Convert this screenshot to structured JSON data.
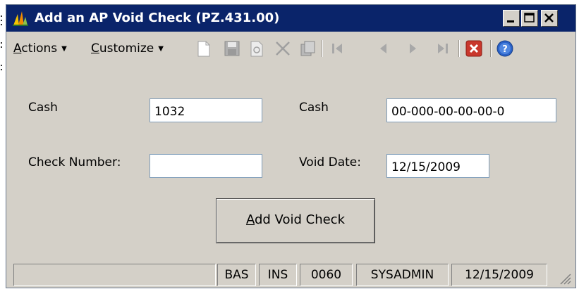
{
  "window": {
    "title": "Add an AP Void Check (PZ.431.00)"
  },
  "menu": {
    "actions_prefix": "A",
    "actions_rest": "ctions",
    "customize_prefix": "C",
    "customize_rest": "ustomize"
  },
  "form": {
    "cash_label_left": "Cash",
    "cash_value_left": "1032",
    "cash_label_right": "Cash",
    "cash_value_right": "00-000-00-00-00-0",
    "check_number_label": "Check Number:",
    "check_number_value": "",
    "void_date_label": "Void Date:",
    "void_date_value": "12/15/2009"
  },
  "button": {
    "add_prefix": "A",
    "add_rest": "dd Void Check"
  },
  "status": {
    "cell_empty": "",
    "bas": "BAS",
    "ins": "INS",
    "code": "0060",
    "user": "SYSADMIN",
    "date": "12/15/2009"
  },
  "colors": {
    "titlebar": "#0a246a",
    "window_bg": "#d4d0c8",
    "delete_red": "#c9372c",
    "help_blue": "#2a62c8"
  },
  "icons": [
    "app-logo-icon",
    "minimize-icon",
    "maximize-icon",
    "close-icon",
    "new-document-icon",
    "save-icon",
    "refresh-icon",
    "delete-x-icon",
    "copy-icon",
    "first-record-icon",
    "previous-record-icon",
    "next-record-icon",
    "last-record-icon",
    "red-close-icon",
    "help-icon"
  ]
}
